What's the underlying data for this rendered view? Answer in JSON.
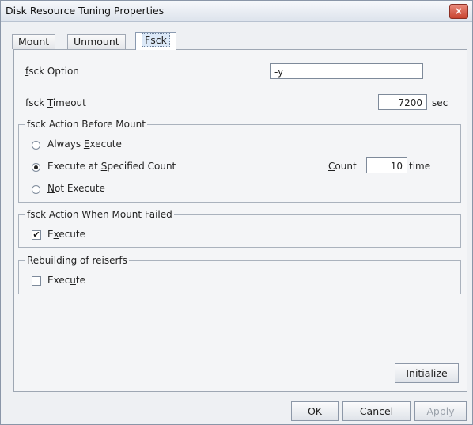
{
  "window": {
    "title": "Disk Resource Tuning Properties",
    "close_label": "×"
  },
  "tabs": [
    {
      "label": "Mount"
    },
    {
      "label": "Unmount"
    },
    {
      "label": "Fsck"
    }
  ],
  "fsck_option": {
    "label_first": "f",
    "label_rest": "sck Option",
    "value": "-y"
  },
  "fsck_timeout": {
    "label_before": "fsck ",
    "label_mnemonic": "T",
    "label_after": "imeout",
    "value": "7200",
    "unit": "sec"
  },
  "action_before_mount": {
    "title": "fsck Action Before Mount",
    "options": [
      {
        "before": "Always ",
        "mnemonic": "E",
        "after": "xecute",
        "selected": false
      },
      {
        "before": "Execute at ",
        "mnemonic": "S",
        "after": "pecified Count",
        "selected": true
      },
      {
        "before": "",
        "mnemonic": "N",
        "after": "ot Execute",
        "selected": false
      }
    ],
    "count": {
      "mnemonic": "C",
      "label_rest": "ount",
      "value": "10",
      "unit": "time"
    }
  },
  "action_when_failed": {
    "title": "fsck Action When Mount Failed",
    "checkbox": {
      "before": "E",
      "mnemonic": "x",
      "after": "ecute",
      "checked": true,
      "mark": "✔"
    }
  },
  "rebuilding": {
    "title": "Rebuilding of reiserfs",
    "checkbox": {
      "before": "Exec",
      "mnemonic": "u",
      "after": "te",
      "checked": false
    }
  },
  "buttons": {
    "initialize": {
      "mnemonic": "I",
      "rest": "nitialize"
    },
    "ok": "OK",
    "cancel": "Cancel",
    "apply": {
      "mnemonic": "A",
      "rest": "pply"
    }
  }
}
